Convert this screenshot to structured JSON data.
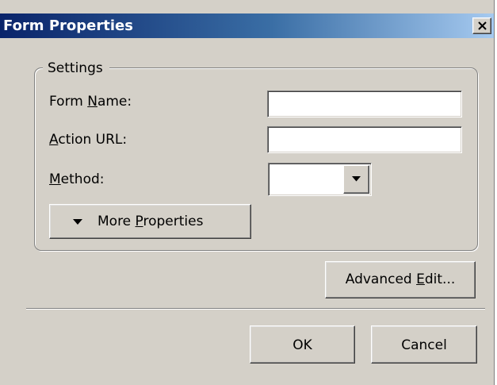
{
  "window": {
    "title": "Form Properties",
    "close_icon": "close-x-icon"
  },
  "settings": {
    "group_label": "Settings",
    "form_name": {
      "label_pre": "Form ",
      "label_mnemonic": "N",
      "label_post": "ame:",
      "value": ""
    },
    "action_url": {
      "label_pre": "",
      "label_mnemonic": "A",
      "label_post": "ction URL:",
      "value": ""
    },
    "method": {
      "label_pre": "",
      "label_mnemonic": "M",
      "label_post": "ethod:",
      "value": "",
      "dropdown_icon": "chevron-down-icon"
    },
    "more_properties": {
      "arrow_icon": "triangle-down-icon",
      "label_pre": "More ",
      "label_mnemonic": "P",
      "label_post": "roperties"
    }
  },
  "advanced_edit": {
    "label_pre": "Advanced ",
    "label_mnemonic": "E",
    "label_post": "dit..."
  },
  "footer": {
    "ok_label": "OK",
    "cancel_label": "Cancel"
  },
  "colors": {
    "face": "#d4d0c8",
    "title_start": "#0a246a",
    "title_end": "#a6caf0"
  }
}
